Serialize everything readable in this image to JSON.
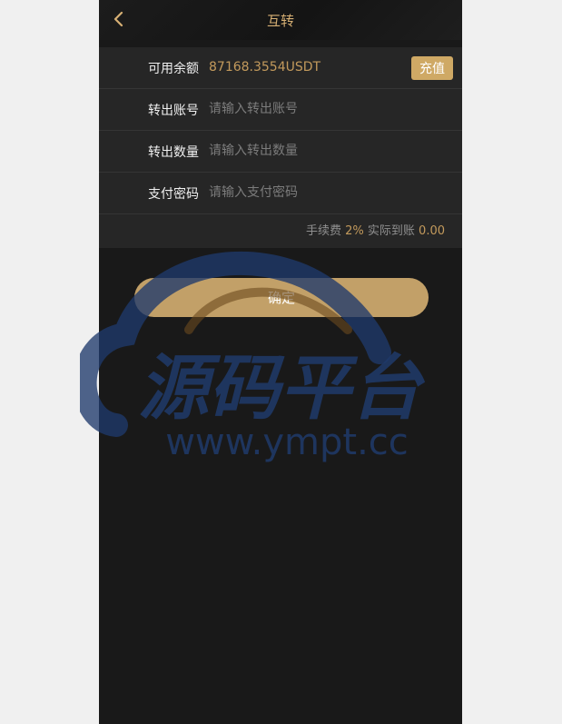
{
  "header": {
    "title": "互转",
    "back_icon": "chevron-left-icon"
  },
  "form": {
    "balance_label": "可用余额",
    "balance_value": "87168.3554USDT",
    "recharge_label": "充值",
    "account_label": "转出账号",
    "account_placeholder": "请输入转出账号",
    "amount_label": "转出数量",
    "amount_placeholder": "请输入转出数量",
    "password_label": "支付密码",
    "password_placeholder": "请输入支付密码"
  },
  "fee": {
    "fee_label": "手续费",
    "fee_value": "2%",
    "actual_label": "实际到账",
    "actual_value": "0.00"
  },
  "confirm_label": "确定",
  "watermark": {
    "title": "源码平台",
    "url": "www.ympt.cc"
  },
  "colors": {
    "accent": "#c39a5c",
    "button": "#c2a068",
    "background": "#191919"
  }
}
